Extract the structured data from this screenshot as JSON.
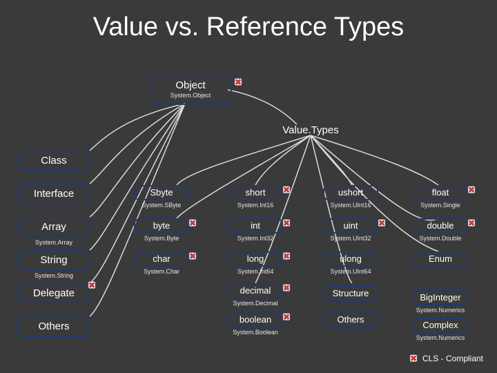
{
  "title": "Value vs. Reference Types",
  "root": {
    "name": "Object",
    "system": "System.Object",
    "cls": true
  },
  "valueTypesHeader": "Value.Types",
  "referenceTypes": [
    {
      "name": "Class"
    },
    {
      "name": "Interface"
    },
    {
      "name": "Array",
      "system": "System.Array"
    },
    {
      "name": "String",
      "system": "System.String"
    },
    {
      "name": "Delegate",
      "cls": true
    },
    {
      "name": "Others"
    }
  ],
  "valueGrid": [
    [
      {
        "name": "Sbyte",
        "system": "System.SByte"
      },
      {
        "name": "short",
        "system": "System.Int16",
        "cls": true
      },
      {
        "name": "ushort",
        "system": "System.UInt16"
      },
      {
        "name": "float",
        "system": "System.Single",
        "cls": true
      }
    ],
    [
      {
        "name": "byte",
        "system": "System.Byte",
        "cls": true
      },
      {
        "name": "int",
        "system": "System.Int32",
        "cls": true
      },
      {
        "name": "uint",
        "system": "System.UInt32",
        "cls": true
      },
      {
        "name": "double",
        "system": "System.Double",
        "cls": true
      }
    ],
    [
      {
        "name": "char",
        "system": "System.Char",
        "cls": true
      },
      {
        "name": "long",
        "system": "System.Int64",
        "cls": true
      },
      {
        "name": "ulong",
        "system": "System.UInt64"
      },
      {
        "name": "Enum"
      }
    ]
  ],
  "valueExtras": [
    {
      "name": "decimal",
      "system": "System.Decimal",
      "cls": true
    },
    {
      "name": "boolean",
      "system": "System.Boolean",
      "cls": true
    }
  ],
  "valueRight": [
    {
      "name": "Structure"
    },
    {
      "name": "Others"
    }
  ],
  "numerics": [
    {
      "name": "BigInteger",
      "system": "System.Numerics"
    },
    {
      "name": "Complex",
      "system": "System.Numerics"
    }
  ],
  "legend": "CLS - Compliant",
  "colors": {
    "border": "#233a6b",
    "bg": "#3a3a3a",
    "cross": "#c33c3c"
  }
}
